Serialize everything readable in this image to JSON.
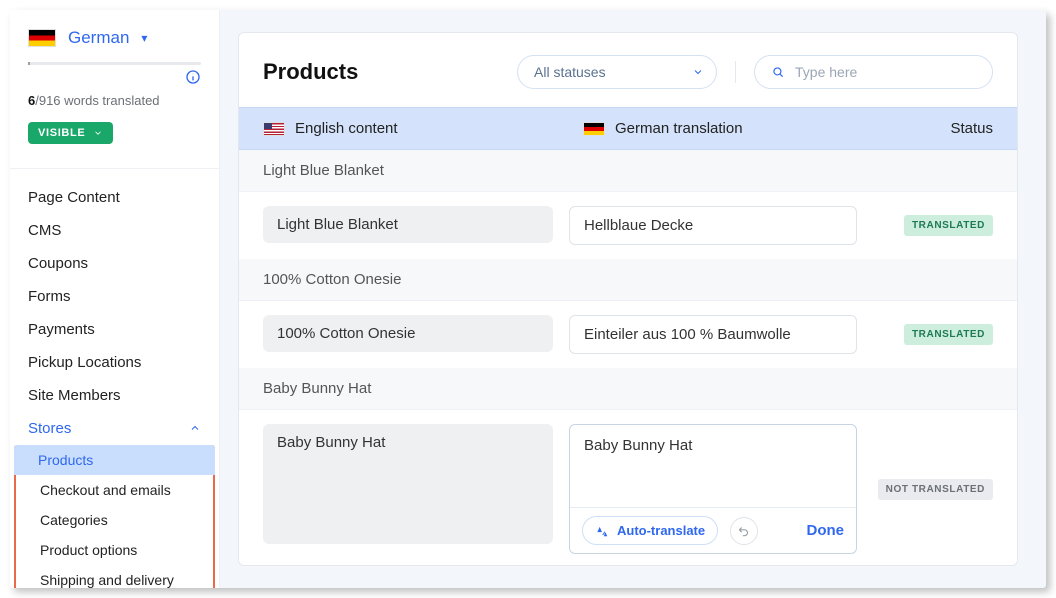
{
  "sidebar": {
    "language": "German",
    "words_done": "6",
    "words_total": "/916 words translated",
    "visibility": "VISIBLE",
    "nav": [
      "Page Content",
      "CMS",
      "Coupons",
      "Forms",
      "Payments",
      "Pickup Locations",
      "Site Members"
    ],
    "parent": "Stores",
    "sub": [
      "Products",
      "Checkout and emails",
      "Categories",
      "Product options",
      "Shipping and delivery"
    ]
  },
  "main": {
    "title": "Products",
    "filter": "All statuses",
    "search_placeholder": "Type here",
    "col_a": "English content",
    "col_b": "German translation",
    "col_c": "Status",
    "badge_translated": "TRANSLATED",
    "badge_not": "NOT TRANSLATED",
    "auto": "Auto-translate",
    "done": "Done"
  },
  "items": [
    {
      "title": "Light Blue Blanket",
      "src": "Light Blue Blanket",
      "trg": "Hellblaue Decke",
      "status": "t"
    },
    {
      "title": "100% Cotton Onesie",
      "src": "100% Cotton Onesie",
      "trg": "Einteiler aus 100 % Baumwolle",
      "status": "t"
    },
    {
      "title": "Baby Bunny Hat",
      "src": "Baby Bunny Hat",
      "trg": "Baby Bunny Hat",
      "status": "nt",
      "editing": true
    }
  ]
}
